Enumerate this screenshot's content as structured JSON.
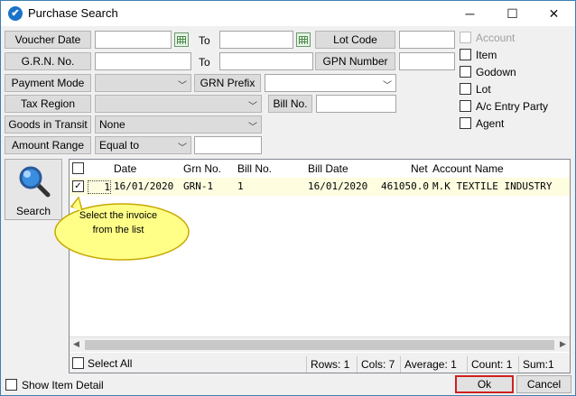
{
  "window": {
    "title": "Purchase Search",
    "icon": "app-icon",
    "controls": {
      "minimize": "─",
      "maximize": "☐",
      "close": "✕"
    }
  },
  "filters": {
    "voucher_date": {
      "label": "Voucher Date",
      "from": "",
      "to_label": "To",
      "to": ""
    },
    "grn_no": {
      "label": "G.R.N. No.",
      "from": "",
      "to_label": "To",
      "to": ""
    },
    "lot_code": {
      "label": "Lot Code",
      "value": ""
    },
    "gpn_number": {
      "label": "GPN Number",
      "value": ""
    },
    "payment_mode": {
      "label": "Payment Mode",
      "value": ""
    },
    "grn_prefix": {
      "label": "GRN Prefix",
      "value": ""
    },
    "tax_region": {
      "label": "Tax Region",
      "value": ""
    },
    "bill_no": {
      "label": "Bill No.",
      "value": ""
    },
    "goods_in_transit": {
      "label": "Goods in Transit",
      "value": "None"
    },
    "amount_range": {
      "label": "Amount Range",
      "value": "Equal to",
      "amount": ""
    }
  },
  "options": [
    {
      "label": "Account",
      "checked": false,
      "disabled": true
    },
    {
      "label": "Item",
      "checked": false,
      "disabled": false
    },
    {
      "label": "Godown",
      "checked": false,
      "disabled": false
    },
    {
      "label": "Lot",
      "checked": false,
      "disabled": false
    },
    {
      "label": "A/c Entry Party",
      "checked": false,
      "disabled": false
    },
    {
      "label": "Agent",
      "checked": false,
      "disabled": false
    }
  ],
  "search_button": {
    "label": "Search",
    "icon": "magnifier-icon"
  },
  "grid": {
    "columns": [
      "Date",
      "Grn No.",
      "Bill No.",
      "Bill Date",
      "Net",
      "Account Name"
    ],
    "rows": [
      {
        "checked": true,
        "num": "1",
        "date": "16/01/2020",
        "grn_no": "GRN-1",
        "bill_no": "1",
        "bill_date": "16/01/2020",
        "net": "461050.0",
        "account_name": "M.K TEXTILE INDUSTRY"
      }
    ]
  },
  "tooltip": {
    "line1": "Select the invoice",
    "line2": "from the list"
  },
  "footer": {
    "select_all": "Select All",
    "rows": "Rows: 1",
    "cols": "Cols: 7",
    "average": "Average: 1",
    "count": "Count: 1",
    "sum": "Sum:1"
  },
  "bottom": {
    "show_item_detail": "Show Item Detail",
    "ok": "Ok",
    "cancel": "Cancel"
  },
  "colors": {
    "accent_border": "#3c7fb1",
    "row_highlight": "#fffde0",
    "bubble": "#ffff88",
    "ok_border": "#d02020"
  }
}
